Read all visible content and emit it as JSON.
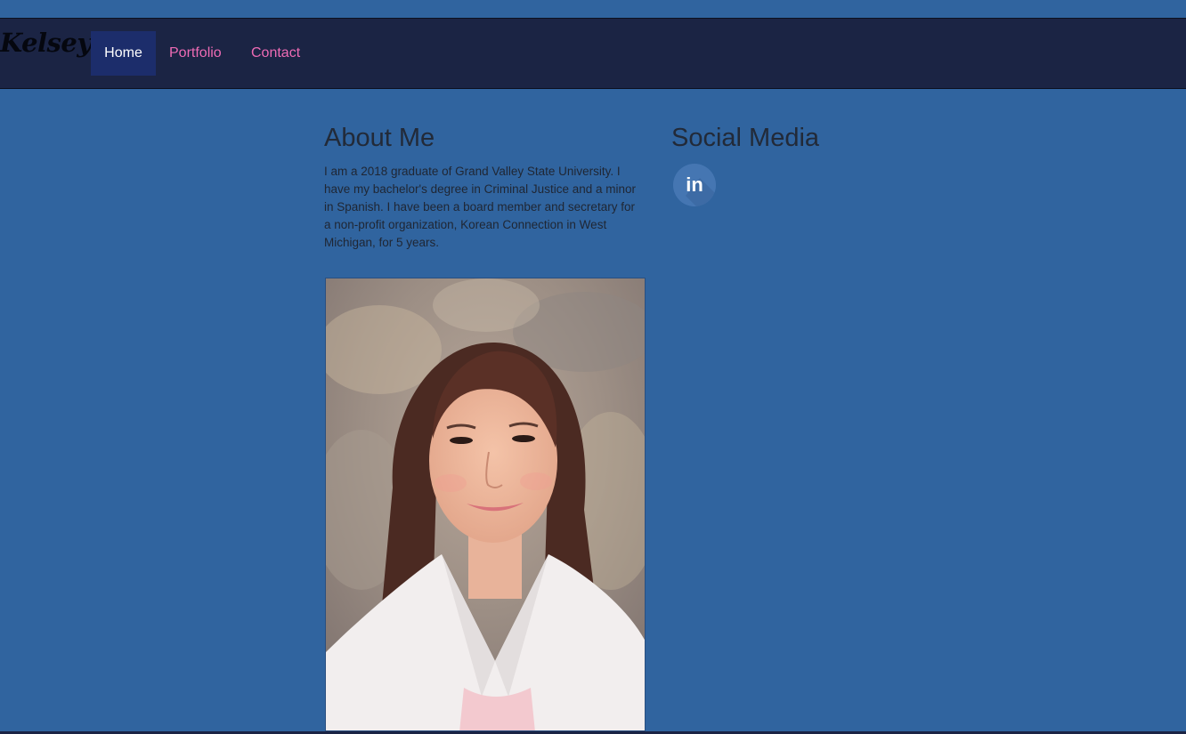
{
  "nav": {
    "brand": "Kelsey",
    "items": [
      {
        "label": "Home",
        "active": true
      },
      {
        "label": "Portfolio",
        "active": false
      },
      {
        "label": "Contact",
        "active": false
      }
    ]
  },
  "about": {
    "heading": "About Me",
    "text": "I am a 2018 graduate of Grand Valley State University. I have my bachelor's degree in Criminal Justice and a minor in Spanish. I have been a board member and secretary for a non-profit organization, Korean Connection in West Michigan, for 5 years."
  },
  "social": {
    "heading": "Social Media",
    "linkedin_icon": "linkedin-icon",
    "linkedin_text": "in"
  },
  "colors": {
    "background": "#30649f",
    "navbar": "#1b2444",
    "nav_active": "#1c2d6b",
    "nav_link": "#ee6bb5",
    "heading": "#222a38"
  }
}
